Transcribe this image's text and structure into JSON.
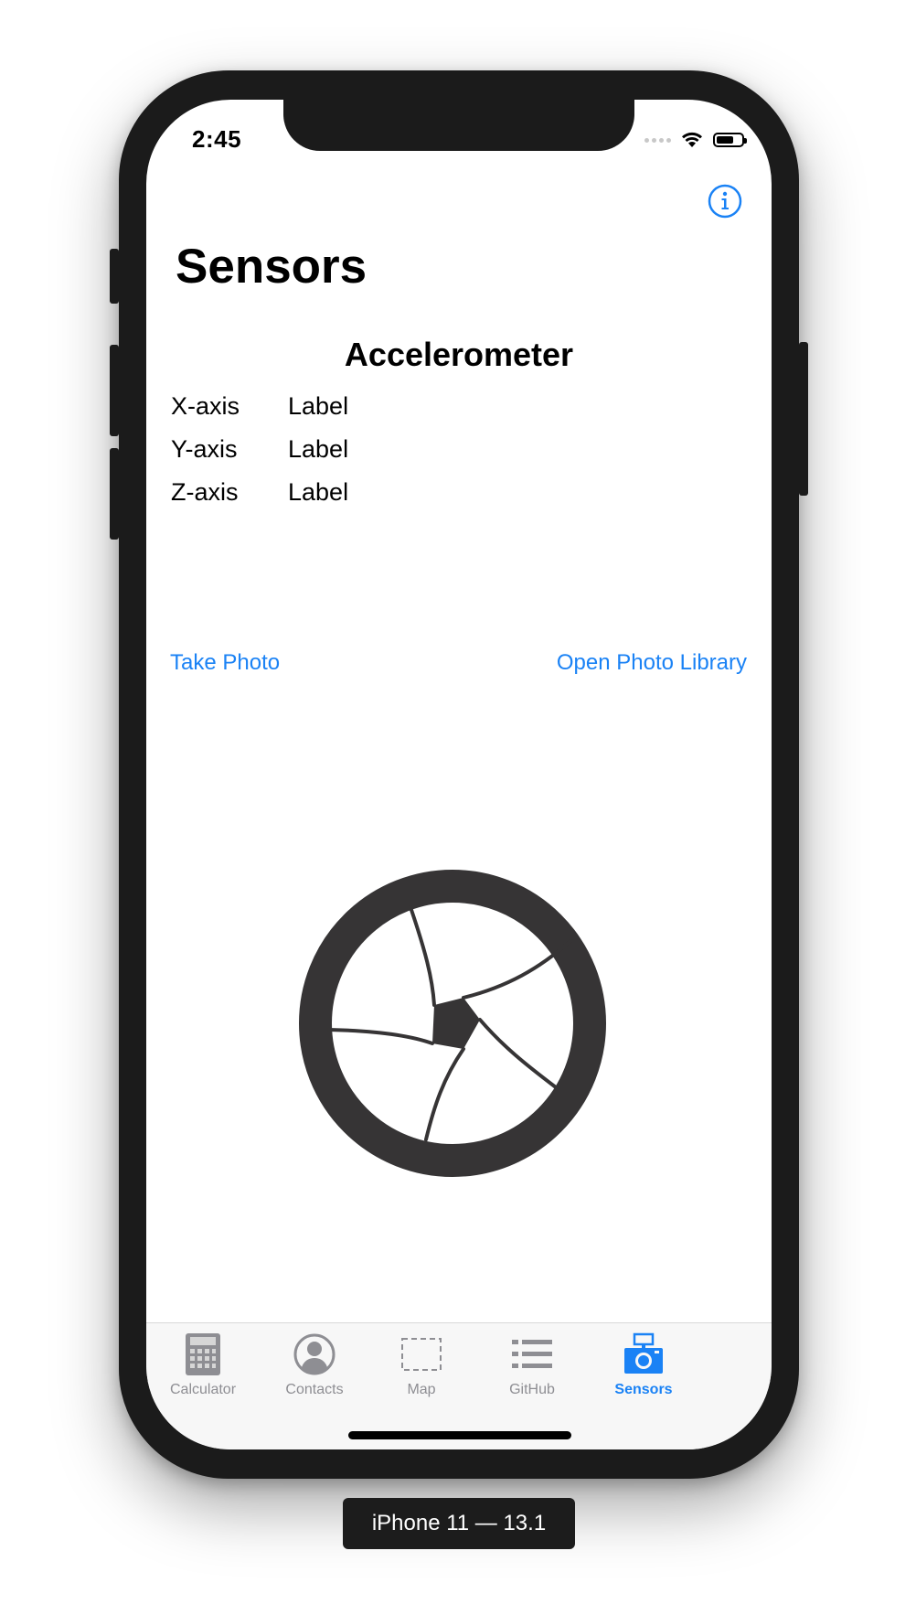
{
  "status_bar": {
    "time": "2:45"
  },
  "nav": {
    "title": "Sensors"
  },
  "accelerometer": {
    "heading": "Accelerometer",
    "axes": [
      {
        "name": "X-axis",
        "value": "Label"
      },
      {
        "name": "Y-axis",
        "value": "Label"
      },
      {
        "name": "Z-axis",
        "value": "Label"
      }
    ]
  },
  "actions": {
    "take_photo": "Take Photo",
    "open_library": "Open Photo Library"
  },
  "image": {
    "icon": "camera-aperture-icon"
  },
  "tabbar": {
    "active_index": 4,
    "items": [
      {
        "label": "Calculator",
        "icon": "calculator-icon"
      },
      {
        "label": "Contacts",
        "icon": "person-icon"
      },
      {
        "label": "Map",
        "icon": "dashed-square-icon"
      },
      {
        "label": "GitHub",
        "icon": "list-icon"
      },
      {
        "label": "Sensors",
        "icon": "camera-icon"
      }
    ]
  },
  "device_label": "iPhone 11 — 13.1",
  "colors": {
    "accent": "#1a82f5",
    "inactive_tab": "#8e8e93",
    "device_frame": "#1b1b1b"
  }
}
